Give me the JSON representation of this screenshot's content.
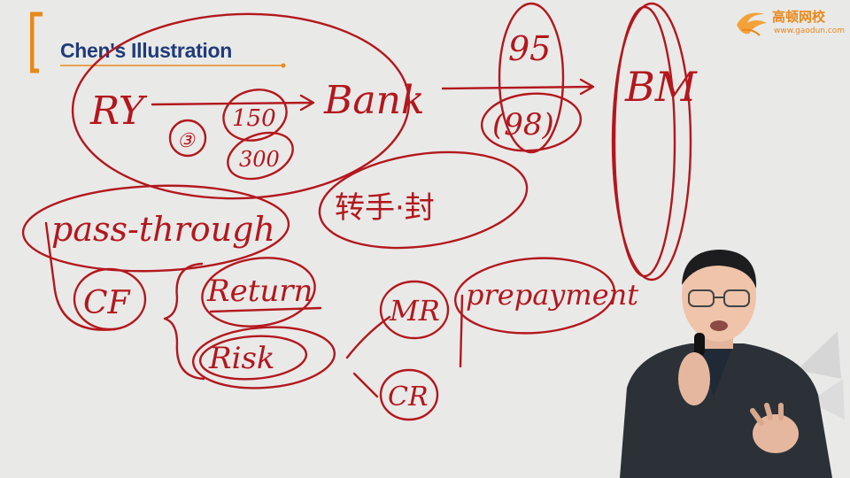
{
  "title": "Chen's Illustration",
  "logo": {
    "name_cn": "高顿网校",
    "url": "www.gaodun.com"
  },
  "colors": {
    "ink": "#b3171d",
    "title": "#1f3b7a",
    "accent": "#e8891c",
    "background": "#e9e9e8"
  },
  "annotations": {
    "ry": "RY",
    "bank": "Bank",
    "bm": "BM",
    "n3": "③",
    "v150": "150",
    "v300": "300",
    "v95": "95",
    "v98": "(98)",
    "pass_through": "pass-through",
    "chinese_note": "转手·封",
    "cf": "CF",
    "return": "Return",
    "risk": "Risk",
    "mr": "MR",
    "cr": "CR",
    "prepayment": "prepayment"
  }
}
